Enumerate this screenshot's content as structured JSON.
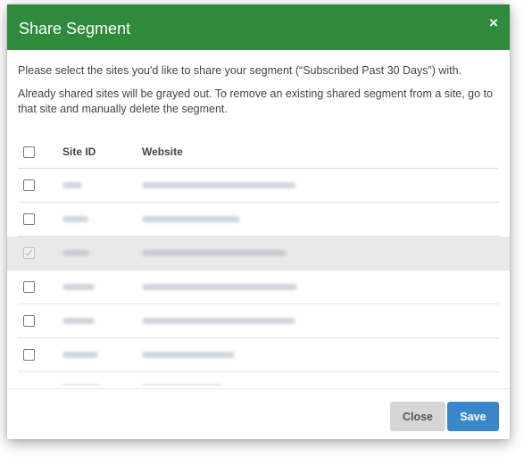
{
  "dialog": {
    "title": "Share Segment",
    "close_glyph": "×",
    "intro_line1": "Please select the sites you'd like to share your segment (“Subscribed Past 30 Days”) with.",
    "intro_line2": "Already shared sites will be grayed out. To remove an existing shared segment from a site, go to that site and manually delete the segment."
  },
  "table": {
    "columns": [
      "Site ID",
      "Website"
    ],
    "rows": [
      {
        "site_id": "",
        "website": "",
        "checked": false,
        "shared": false
      },
      {
        "site_id": "",
        "website": "",
        "checked": false,
        "shared": false
      },
      {
        "site_id": "",
        "website": "",
        "checked": true,
        "shared": true
      },
      {
        "site_id": "",
        "website": "",
        "checked": false,
        "shared": false
      },
      {
        "site_id": "",
        "website": "",
        "checked": false,
        "shared": false
      },
      {
        "site_id": "",
        "website": "",
        "checked": false,
        "shared": false
      }
    ]
  },
  "footer": {
    "close_label": "Close",
    "save_label": "Save"
  },
  "colors": {
    "header_bg": "#2f8a3c",
    "save_bg": "#3b86c8",
    "close_bg": "#d6d6d6",
    "shared_row_bg": "#e9e9e9"
  }
}
